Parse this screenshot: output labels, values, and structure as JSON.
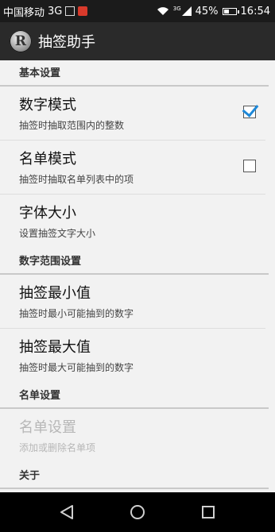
{
  "status_bar": {
    "carrier": "中国移动",
    "network": "3G",
    "signal_label": "3G",
    "battery_percent": "45%",
    "battery_level": 0.45,
    "time": "16:54"
  },
  "action_bar": {
    "app_icon_letter": "R",
    "title": "抽签助手"
  },
  "sections": {
    "basic": {
      "title": "基本设置",
      "number_mode": {
        "title": "数字模式",
        "summary": "抽签时抽取范围内的整数",
        "checked": true
      },
      "list_mode": {
        "title": "名单模式",
        "summary": "抽签时抽取名单列表中的项",
        "checked": false
      },
      "font_size": {
        "title": "字体大小",
        "summary": "设置抽签文字大小"
      }
    },
    "range": {
      "title": "数字范围设置",
      "min": {
        "title": "抽签最小值",
        "summary": "抽签时最小可能抽到的数字"
      },
      "max": {
        "title": "抽签最大值",
        "summary": "抽签时最大可能抽到的数字"
      }
    },
    "list": {
      "title": "名单设置",
      "list_settings": {
        "title": "名单设置",
        "summary": "添加或删除名单项",
        "enabled": false
      }
    },
    "about": {
      "title": "关于"
    }
  },
  "nav_bar": {
    "icons": [
      "back-icon",
      "home-icon",
      "recents-icon"
    ]
  }
}
